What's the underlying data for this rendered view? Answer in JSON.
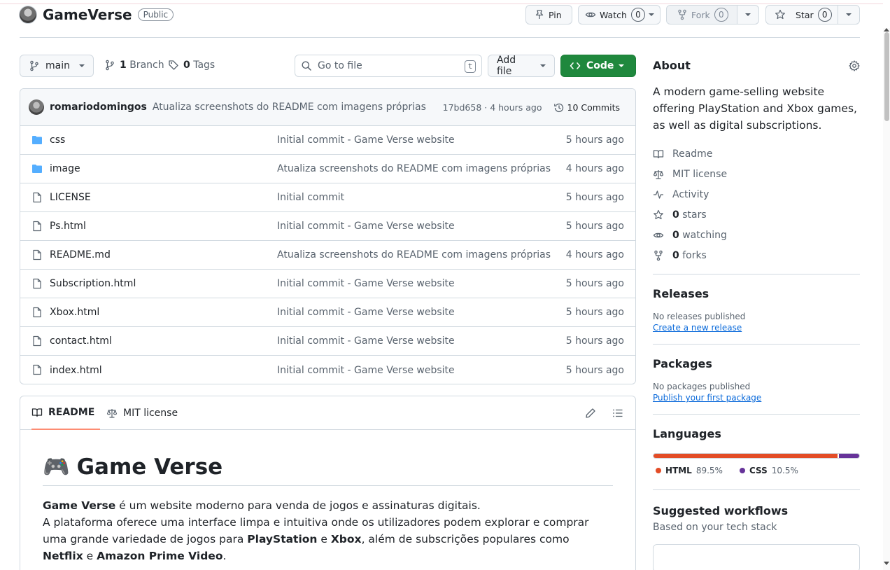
{
  "repo": {
    "name": "GameVerse",
    "visibility": "Public"
  },
  "header_actions": {
    "pin": "Pin",
    "watch": "Watch",
    "watch_count": "0",
    "fork": "Fork",
    "fork_count": "0",
    "star": "Star",
    "star_count": "0"
  },
  "toolbar": {
    "branch": "main",
    "branch_count": "1",
    "branch_label": "Branch",
    "tag_count": "0",
    "tag_label": "Tags",
    "search_placeholder": "Go to file",
    "search_shortcut": "t",
    "add_file": "Add file",
    "code": "Code"
  },
  "latest_commit": {
    "author": "romariodomingos",
    "message": "Atualiza screenshots do README com imagens próprias",
    "hash_time": "17bd658 · 4 hours ago",
    "commits": "10 Commits"
  },
  "files": [
    {
      "name": "css",
      "type": "folder",
      "message": "Initial commit - Game Verse website",
      "time": "5 hours ago"
    },
    {
      "name": "image",
      "type": "folder",
      "message": "Atualiza screenshots do README com imagens próprias",
      "time": "4 hours ago"
    },
    {
      "name": "LICENSE",
      "type": "file",
      "message": "Initial commit",
      "time": "5 hours ago"
    },
    {
      "name": "Ps.html",
      "type": "file",
      "message": "Initial commit - Game Verse website",
      "time": "5 hours ago"
    },
    {
      "name": "README.md",
      "type": "file",
      "message": "Atualiza screenshots do README com imagens próprias",
      "time": "4 hours ago"
    },
    {
      "name": "Subscription.html",
      "type": "file",
      "message": "Initial commit - Game Verse website",
      "time": "5 hours ago"
    },
    {
      "name": "Xbox.html",
      "type": "file",
      "message": "Initial commit - Game Verse website",
      "time": "5 hours ago"
    },
    {
      "name": "contact.html",
      "type": "file",
      "message": "Initial commit - Game Verse website",
      "time": "5 hours ago"
    },
    {
      "name": "index.html",
      "type": "file",
      "message": "Initial commit - Game Verse website",
      "time": "5 hours ago"
    }
  ],
  "readme": {
    "tab_readme": "README",
    "tab_license": "MIT license",
    "title_emoji": "🎮",
    "title": "Game Verse",
    "p1_bold": "Game Verse",
    "p1_rest": " é um website moderno para venda de jogos e assinaturas digitais.",
    "p2_a": "A plataforma oferece uma interface limpa e intuitiva onde os utilizadores podem explorar e comprar uma grande variedade de jogos para ",
    "p2_ps": "PlayStation",
    "p2_e": " e ",
    "p2_xbox": "Xbox",
    "p2_b": ", além de subscrições populares como ",
    "p2_netflix": "Netflix",
    "p2_e2": " e ",
    "p2_prime": "Amazon Prime Video",
    "p2_end": "."
  },
  "about": {
    "title": "About",
    "description": "A modern game-selling website offering PlayStation and Xbox games, as well as digital subscriptions.",
    "readme": "Readme",
    "license": "MIT license",
    "activity": "Activity",
    "stars_count": "0",
    "stars_label": "stars",
    "watching_count": "0",
    "watching_label": "watching",
    "forks_count": "0",
    "forks_label": "forks"
  },
  "releases": {
    "title": "Releases",
    "empty": "No releases published",
    "link": "Create a new release"
  },
  "packages": {
    "title": "Packages",
    "empty": "No packages published",
    "link": "Publish your first package"
  },
  "languages": {
    "title": "Languages",
    "items": [
      {
        "name": "HTML",
        "percent": "89.5%",
        "value": 89.5,
        "color": "#e34c26"
      },
      {
        "name": "CSS",
        "percent": "10.5%",
        "value": 10.5,
        "color": "#663399"
      }
    ]
  },
  "workflows": {
    "title": "Suggested workflows",
    "subtitle": "Based on your tech stack"
  },
  "colors": {
    "primary_green": "#1f883d",
    "link_blue": "#0969da",
    "folder_blue": "#54aeff",
    "tab_accent": "#fd8c73"
  }
}
